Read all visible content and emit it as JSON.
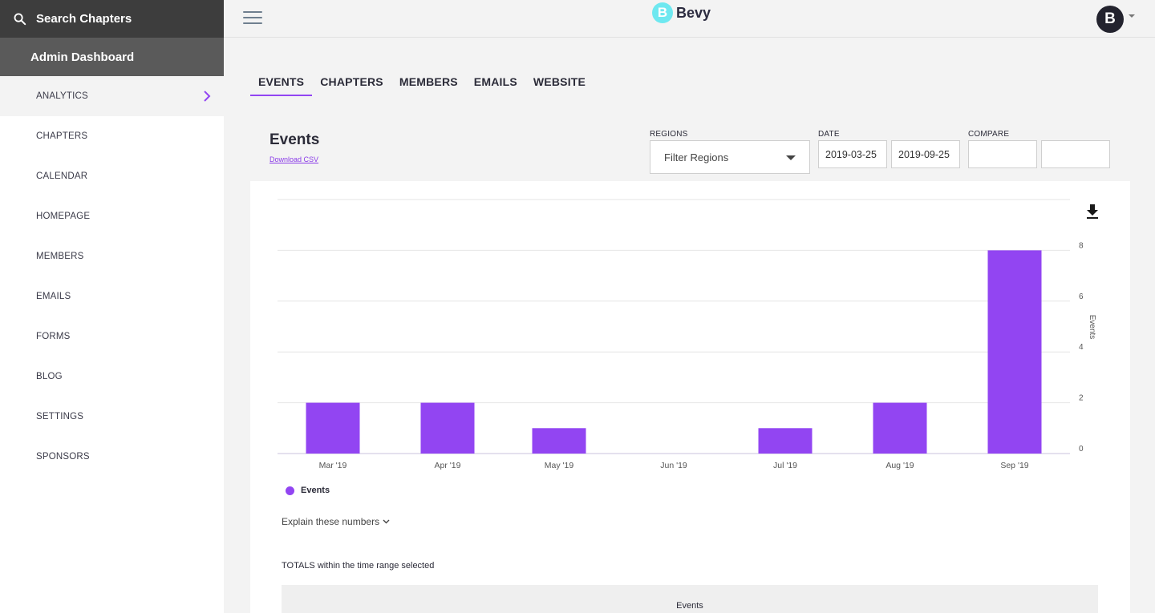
{
  "sidebar": {
    "search_label": "Search Chapters",
    "admin_label": "Admin Dashboard",
    "items": [
      {
        "label": "ANALYTICS",
        "active": true
      },
      {
        "label": "CHAPTERS"
      },
      {
        "label": "CALENDAR"
      },
      {
        "label": "HOMEPAGE"
      },
      {
        "label": "MEMBERS"
      },
      {
        "label": "EMAILS"
      },
      {
        "label": "FORMS"
      },
      {
        "label": "BLOG"
      },
      {
        "label": "SETTINGS"
      },
      {
        "label": "SPONSORS"
      }
    ]
  },
  "topbar": {
    "logo_mark": "B",
    "logo_text": "Bevy",
    "avatar_letter": "B"
  },
  "tabs": [
    {
      "label": "EVENTS",
      "active": true
    },
    {
      "label": "CHAPTERS"
    },
    {
      "label": "MEMBERS"
    },
    {
      "label": "EMAILS"
    },
    {
      "label": "WEBSITE"
    }
  ],
  "section": {
    "title": "Events",
    "csv_link": "Download CSV"
  },
  "filters": {
    "regions_label": "REGIONS",
    "regions_placeholder": "Filter Regions",
    "date_label": "DATE",
    "date_start": "2019-03-25",
    "date_end": "2019-09-25",
    "compare_label": "COMPARE",
    "compare_start": "",
    "compare_end": ""
  },
  "chart_data": {
    "type": "bar",
    "categories": [
      "Mar '19",
      "Apr '19",
      "May '19",
      "Jun '19",
      "Jul '19",
      "Aug '19",
      "Sep '19"
    ],
    "series": [
      {
        "name": "Events",
        "values": [
          2,
          2,
          1,
          0,
          1,
          2,
          8
        ],
        "color": "#9245f2"
      }
    ],
    "ylabel": "Events",
    "ylim": [
      0,
      10
    ],
    "yticks": [
      0,
      2,
      4,
      6,
      8
    ],
    "y_axis_side": "right",
    "grid": true,
    "legend_position": "bottom-left"
  },
  "explain_label": "Explain these numbers",
  "totals": {
    "caption": "TOTALS within the time range selected",
    "column_header": "Events"
  },
  "colors": {
    "accent": "#9245f2",
    "sidebar_search_bg": "#3d3d3d",
    "sidebar_admin_bg": "#5a5a5a",
    "logo": "#6ee8f0"
  }
}
